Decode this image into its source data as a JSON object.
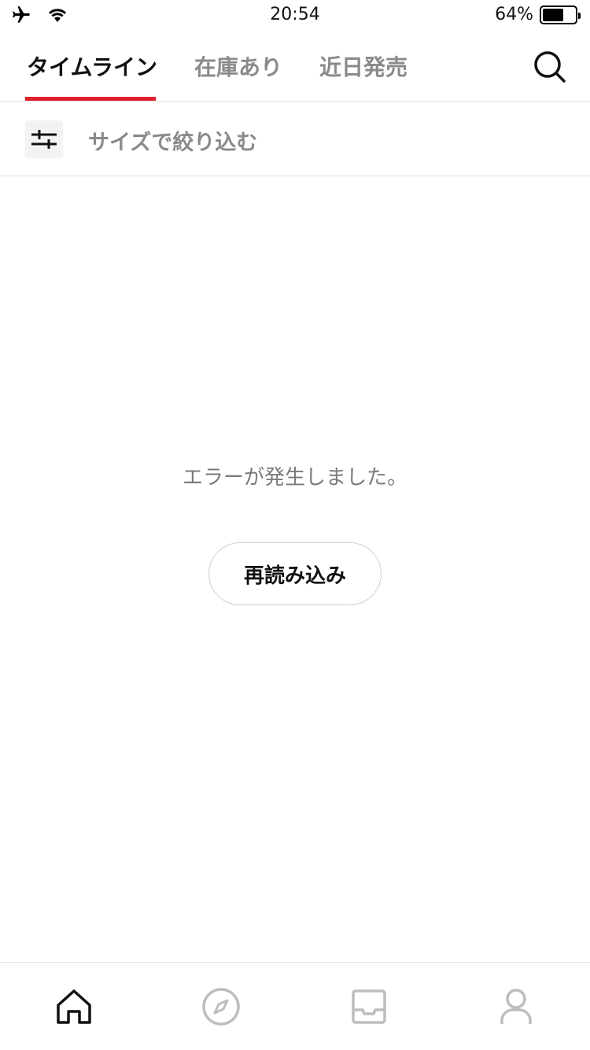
{
  "status_bar": {
    "time": "20:54",
    "battery_percent": "64%",
    "battery_level": 0.64,
    "icons": [
      "airplane-icon",
      "wifi-icon",
      "battery-icon"
    ]
  },
  "tabs": [
    {
      "label": "タイムライン",
      "active": true
    },
    {
      "label": "在庫あり",
      "active": false
    },
    {
      "label": "近日発売",
      "active": false
    }
  ],
  "filter": {
    "label": "サイズで絞り込む",
    "icon": "sliders-icon"
  },
  "error": {
    "message": "エラーが発生しました。",
    "reload_label": "再読み込み"
  },
  "bottom_nav": {
    "items": [
      {
        "icon": "home-icon",
        "active": true
      },
      {
        "icon": "compass-icon",
        "active": false
      },
      {
        "icon": "inbox-icon",
        "active": false
      },
      {
        "icon": "profile-icon",
        "active": false
      }
    ]
  },
  "colors": {
    "accent": "#e01e2b",
    "inactive_text": "#8a8a8a",
    "active_text": "#111111"
  }
}
